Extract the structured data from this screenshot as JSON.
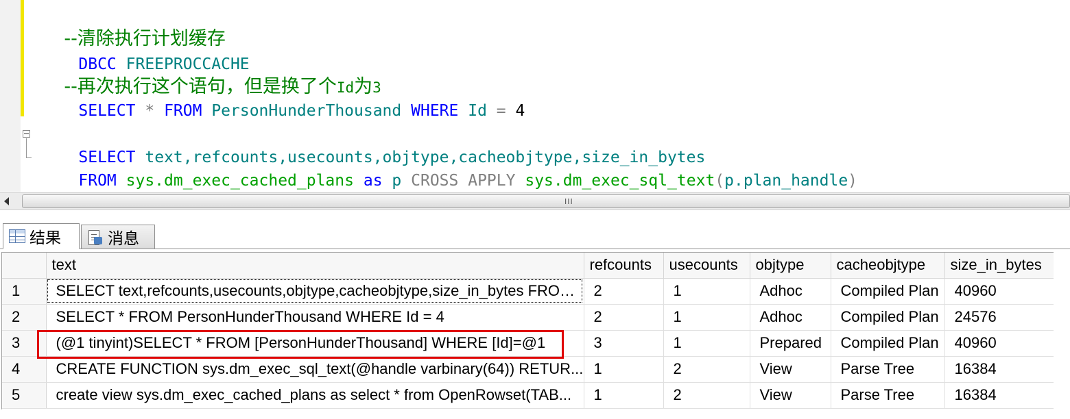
{
  "editor": {
    "lines": [
      {
        "comment": "--清除执行计划缓存"
      },
      {
        "kw": "DBCC",
        "obj": "FREEPROCCACHE"
      },
      {
        "comment_a": "--再次执行这个语句，但是换了个",
        "comment_b": "Id",
        "comment_c": "为",
        "comment_d": "3"
      },
      {
        "kw1": "SELECT",
        "op1": "*",
        "kw2": "FROM",
        "obj": "PersonHunderThousand",
        "kw3": "WHERE",
        "col": "Id",
        "op2": "=",
        "num": "4"
      },
      {
        "kw": "SELECT",
        "cols": "text,refcounts,usecounts,objtype,cacheobjtype,size_in_bytes"
      },
      {
        "kw1": "FROM",
        "sys1": "sys.dm_exec_cached_plans",
        "kw2": "as",
        "alias": "p",
        "op1": "CROSS",
        "op2": "APPLY",
        "sys2": "sys.dm_exec_sql_text",
        "p_open": "(",
        "arg": "p.plan_handle",
        "p_close": ")"
      }
    ]
  },
  "scrollbar": {
    "grip": "III"
  },
  "tabs": [
    {
      "label": "结果",
      "icon": "results-grid-icon"
    },
    {
      "label": "消息",
      "icon": "messages-icon"
    }
  ],
  "results": {
    "columns": [
      "text",
      "refcounts",
      "usecounts",
      "objtype",
      "cacheobjtype",
      "size_in_bytes"
    ],
    "rows": [
      {
        "num": "1",
        "text": "SELECT text,refcounts,usecounts,objtype,cacheobjtype,size_in_bytes  FROM...",
        "refcounts": "2",
        "usecounts": "1",
        "objtype": "Adhoc",
        "cacheobjtype": "Compiled Plan",
        "size_in_bytes": "40960"
      },
      {
        "num": "2",
        "text": "SELECT * FROM PersonHunderThousand WHERE Id = 4",
        "refcounts": "2",
        "usecounts": "1",
        "objtype": "Adhoc",
        "cacheobjtype": "Compiled Plan",
        "size_in_bytes": "24576"
      },
      {
        "num": "3",
        "text": "(@1 tinyint)SELECT * FROM [PersonHunderThousand] WHERE [Id]=@1",
        "refcounts": "3",
        "usecounts": "1",
        "objtype": "Prepared",
        "cacheobjtype": "Compiled Plan",
        "size_in_bytes": "40960"
      },
      {
        "num": "4",
        "text": "CREATE FUNCTION sys.dm_exec_sql_text(@handle varbinary(64))  RETUR...",
        "refcounts": "1",
        "usecounts": "2",
        "objtype": "View",
        "cacheobjtype": "Parse Tree",
        "size_in_bytes": "16384"
      },
      {
        "num": "5",
        "text": " create view sys.dm_exec_cached_plans as select * from OpenRowset(TAB...",
        "refcounts": "1",
        "usecounts": "2",
        "objtype": "View",
        "cacheobjtype": "Parse Tree",
        "size_in_bytes": "16384"
      }
    ]
  },
  "colors": {
    "highlight": "#e00000",
    "keyword": "#0000ff",
    "comment": "#008000",
    "object": "#008080"
  }
}
